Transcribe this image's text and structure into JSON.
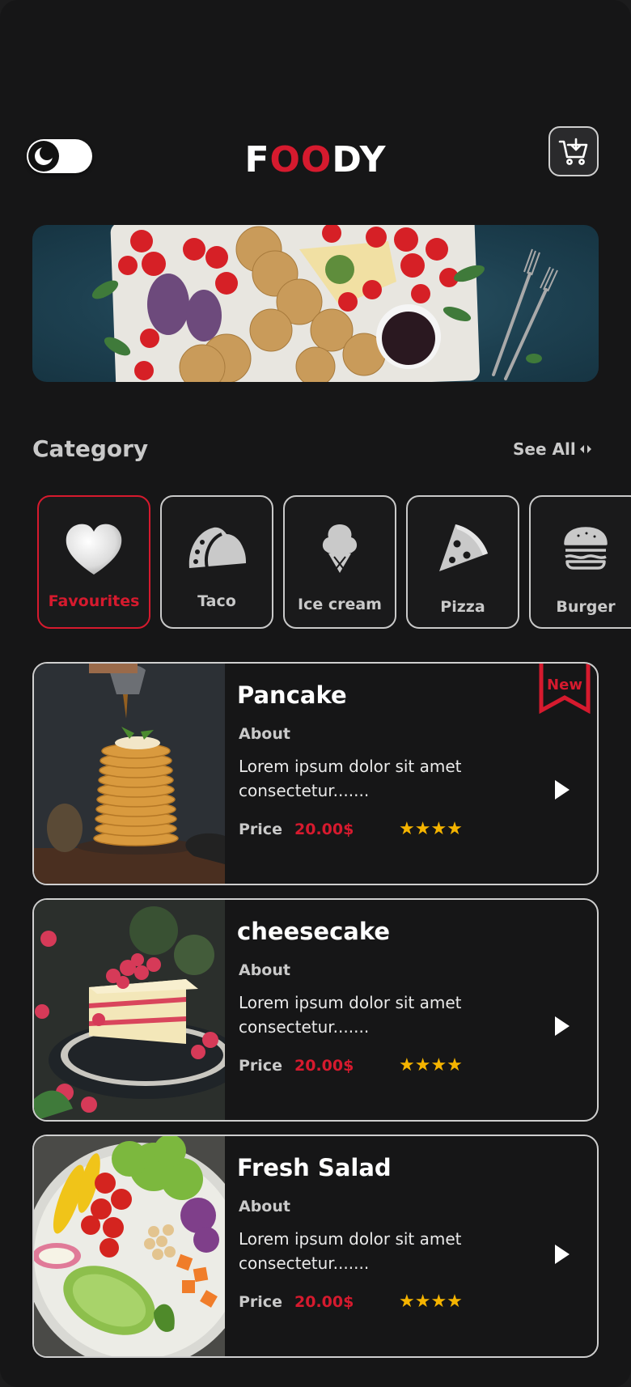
{
  "header": {
    "logo_parts": [
      "F",
      "OO",
      "DY"
    ],
    "theme_toggle": "dark-mode-moon-icon",
    "cart_icon": "cart-download-icon"
  },
  "category": {
    "title": "Category",
    "see_all": "See All"
  },
  "categories": [
    {
      "label": "Favourites",
      "icon": "heart-icon",
      "active": true
    },
    {
      "label": "Taco",
      "icon": "taco-icon",
      "active": false
    },
    {
      "label": "Ice cream",
      "icon": "ice-cream-icon",
      "active": false
    },
    {
      "label": "Pizza",
      "icon": "pizza-icon",
      "active": false
    },
    {
      "label": "Burger",
      "icon": "burger-icon",
      "active": false
    }
  ],
  "foods": [
    {
      "name": "Pancake",
      "about": "About",
      "description": "Lorem ipsum dolor sit amet consectetur.......",
      "price_label": "Price",
      "price": "20.00$",
      "stars": "★★★★",
      "badge": "New"
    },
    {
      "name": "cheesecake",
      "about": "About",
      "description": "Lorem ipsum dolor sit amet consectetur.......",
      "price_label": "Price",
      "price": "20.00$",
      "stars": "★★★★"
    },
    {
      "name": "Fresh Salad",
      "about": "About",
      "description": "Lorem ipsum dolor sit amet consectetur.......",
      "price_label": "Price",
      "price": "20.00$",
      "stars": "★★★★"
    }
  ],
  "colors": {
    "accent": "#d61a2e",
    "background": "#161617",
    "star": "#f5b400"
  }
}
